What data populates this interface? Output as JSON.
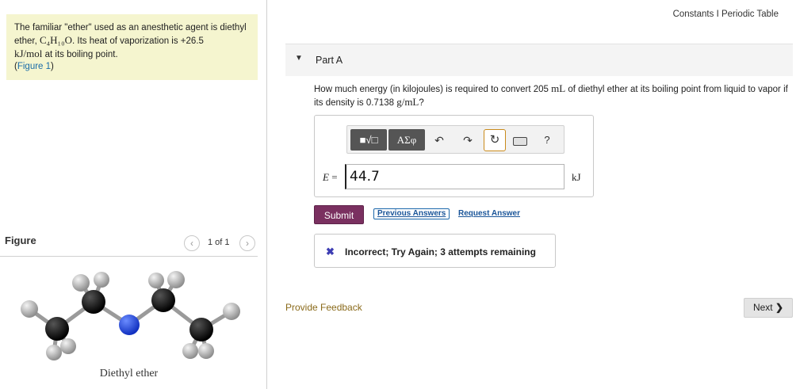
{
  "intro": {
    "text_1": "The familiar \"ether\" used as an anesthetic agent is diethyl ether, ",
    "formula": "C₄H₁₀O",
    "text_2": ". Its heat of vaporization is +26.5",
    "unit": "kJ/mol",
    "text_3": " at its boiling point.",
    "figure_link": "Figure 1"
  },
  "figure": {
    "title": "Figure",
    "page_count": "1 of 1",
    "prev_icon": "chevron-left-icon",
    "next_icon": "chevron-right-icon",
    "caption": "Diethyl ether"
  },
  "topnav": {
    "constants": "Constants",
    "separator": "I",
    "periodic_table": "Periodic Table"
  },
  "part": {
    "title": "Part A",
    "question_1": "How much energy (in kilojoules) is required to convert 205 ",
    "question_unit_1": "mL",
    "question_2": " of diethyl ether at its boiling point from liquid to vapor if its density is 0.7138 ",
    "question_unit_2": "g/mL",
    "question_3": "?"
  },
  "toolbar": {
    "templates_label": "■√□",
    "greek_label": "AΣφ",
    "undo_icon": "undo-icon",
    "redo_icon": "redo-icon",
    "reset_icon": "reset-icon",
    "keyboard_icon": "keyboard-icon",
    "help_label": "?"
  },
  "answer": {
    "variable": "E",
    "equals": " = ",
    "value": "44.7",
    "unit": "kJ"
  },
  "actions": {
    "submit": "Submit",
    "previous_answers": "Previous Answers",
    "request_answer": "Request Answer"
  },
  "feedback": {
    "message": "Incorrect; Try Again; 3 attempts remaining",
    "icon": "x-icon"
  },
  "footer": {
    "provide_feedback": "Provide Feedback",
    "next": "Next"
  },
  "colors": {
    "intro_bg": "#f5f5cf",
    "submit_bg": "#7a3060",
    "link": "#1a5599",
    "feedback_link": "#8a6a1a",
    "carbon": "#111111",
    "oxygen": "#1a3fd6",
    "hydrogen": "#b8b8b8"
  }
}
